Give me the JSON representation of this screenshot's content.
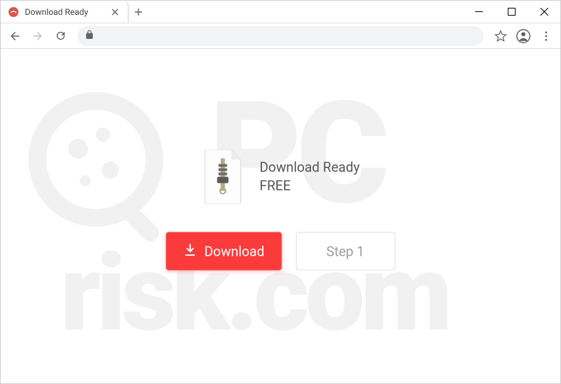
{
  "tab": {
    "title": "Download Ready",
    "favicon": "scam-icon"
  },
  "window": {
    "minimize": "minimize",
    "maximize": "maximize",
    "close": "close"
  },
  "address": {
    "url_display": ""
  },
  "content": {
    "line1": "Download Ready",
    "line2": "FREE"
  },
  "buttons": {
    "download": "Download",
    "step": "Step 1"
  },
  "watermark": {
    "line1": "PC",
    "line2": "risk.com"
  },
  "colors": {
    "download_bg": "#fb3b3b",
    "step_text": "#9e9e9e",
    "text_primary": "#555555"
  }
}
